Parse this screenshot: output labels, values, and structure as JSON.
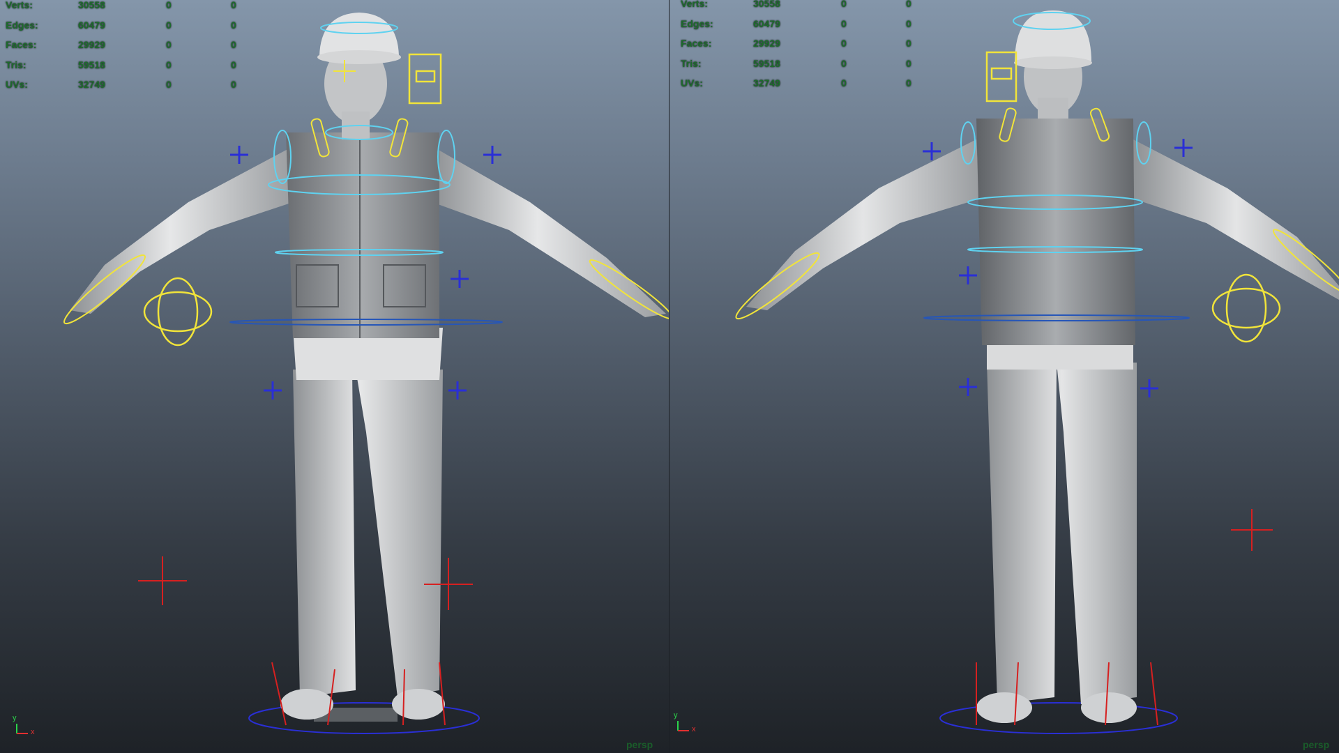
{
  "viewports": [
    {
      "camera": "persp",
      "stats": {
        "headers": [
          "Verts:",
          "Edges:",
          "Faces:",
          "Tris:",
          "UVs:"
        ],
        "rows": [
          {
            "label": "Verts:",
            "a": "30558",
            "b": "0",
            "c": "0"
          },
          {
            "label": "Edges:",
            "a": "60479",
            "b": "0",
            "c": "0"
          },
          {
            "label": "Faces:",
            "a": "29929",
            "b": "0",
            "c": "0"
          },
          {
            "label": "Tris:",
            "a": "59518",
            "b": "0",
            "c": "0"
          },
          {
            "label": "UVs:",
            "a": "32749",
            "b": "0",
            "c": "0"
          }
        ]
      },
      "axis": {
        "y": "y",
        "x": "x"
      }
    },
    {
      "camera": "persp",
      "stats": {
        "rows": [
          {
            "label": "Verts:",
            "a": "30558",
            "b": "0",
            "c": "0"
          },
          {
            "label": "Edges:",
            "a": "60479",
            "b": "0",
            "c": "0"
          },
          {
            "label": "Faces:",
            "a": "29929",
            "b": "0",
            "c": "0"
          },
          {
            "label": "Tris:",
            "a": "59518",
            "b": "0",
            "c": "0"
          },
          {
            "label": "UVs:",
            "a": "32749",
            "b": "0",
            "c": "0"
          }
        ]
      },
      "axis": {
        "y": "y",
        "x": "x"
      }
    }
  ],
  "colors": {
    "control_yellow": "#f1e43a",
    "control_cyan": "#5fd2f0",
    "control_blue": "#2a2fd6",
    "locator_red": "#d62020",
    "mesh": "#c9cbcd"
  }
}
